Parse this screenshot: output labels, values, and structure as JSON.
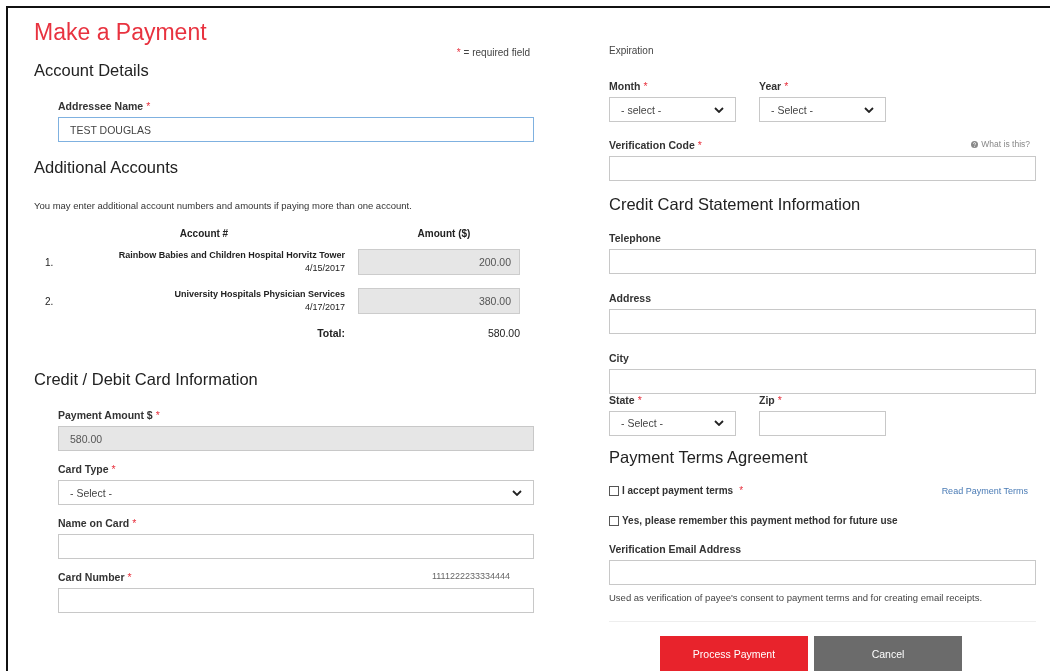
{
  "title": "Make a Payment",
  "legend": {
    "mark": "*",
    "text": "= required field"
  },
  "account_details": {
    "heading": "Account Details",
    "addressee": {
      "label": "Addressee Name",
      "mark": "*",
      "value": "TEST DOUGLAS",
      "focused": true
    }
  },
  "additional_accounts": {
    "heading": "Additional Accounts",
    "note": "You may enter additional account numbers and amounts if paying more than one account.",
    "columns": [
      "Account #",
      "Amount ($)"
    ],
    "rows": [
      {
        "number": "1.",
        "account": "Rainbow Babies and Children Hospital Horvitz Tower",
        "date": "4/15/2017",
        "amount": "200.00"
      },
      {
        "number": "2.",
        "account": "University Hospitals Physician Services",
        "date": "4/17/2017",
        "amount": "380.00"
      }
    ],
    "total_label": "Total:",
    "total": "580.00"
  },
  "card_info": {
    "heading": "Credit / Debit Card Information",
    "fields": [
      {
        "kind": "readonly",
        "label": "Payment Amount $",
        "mark": "*",
        "value": "580.00"
      },
      {
        "kind": "select",
        "label": "Card Type",
        "mark": "*",
        "value": "- Select -"
      },
      {
        "kind": "input",
        "label": "Name on Card",
        "mark": "*"
      },
      {
        "kind": "input",
        "label": "Card Number",
        "mark": "*",
        "hint": "1111222233334444"
      }
    ]
  },
  "expiration": {
    "caption": "Expiration",
    "month": {
      "label": "Month",
      "mark": "*",
      "value": "- select -"
    },
    "year": {
      "label": "Year",
      "mark": "*",
      "value": "- Select -"
    },
    "verification": {
      "label": "Verification Code",
      "mark": "*",
      "help": "What is this?"
    }
  },
  "statement": {
    "heading": "Credit Card Statement Information",
    "fields": [
      {
        "label": "Telephone"
      },
      {
        "label": "Address"
      },
      {
        "label": "City"
      }
    ],
    "state": {
      "label": "State",
      "mark": "*",
      "value": "- Select -"
    },
    "zip": {
      "label": "Zip",
      "mark": "*"
    }
  },
  "terms": {
    "heading": "Payment Terms Agreement",
    "checks": [
      {
        "label": "I accept payment terms",
        "mark": "*",
        "checked": false,
        "link": "Read Payment Terms"
      },
      {
        "label": "Yes, please remember this payment method for future use",
        "checked": false
      }
    ],
    "email_label": "Verification Email Address",
    "email_note": "Used as verification of payee's consent to payment terms and for creating email receipts."
  },
  "buttons": [
    {
      "kind": "primary",
      "label": "Process Payment"
    },
    {
      "kind": "secondary",
      "label": "Cancel"
    }
  ]
}
